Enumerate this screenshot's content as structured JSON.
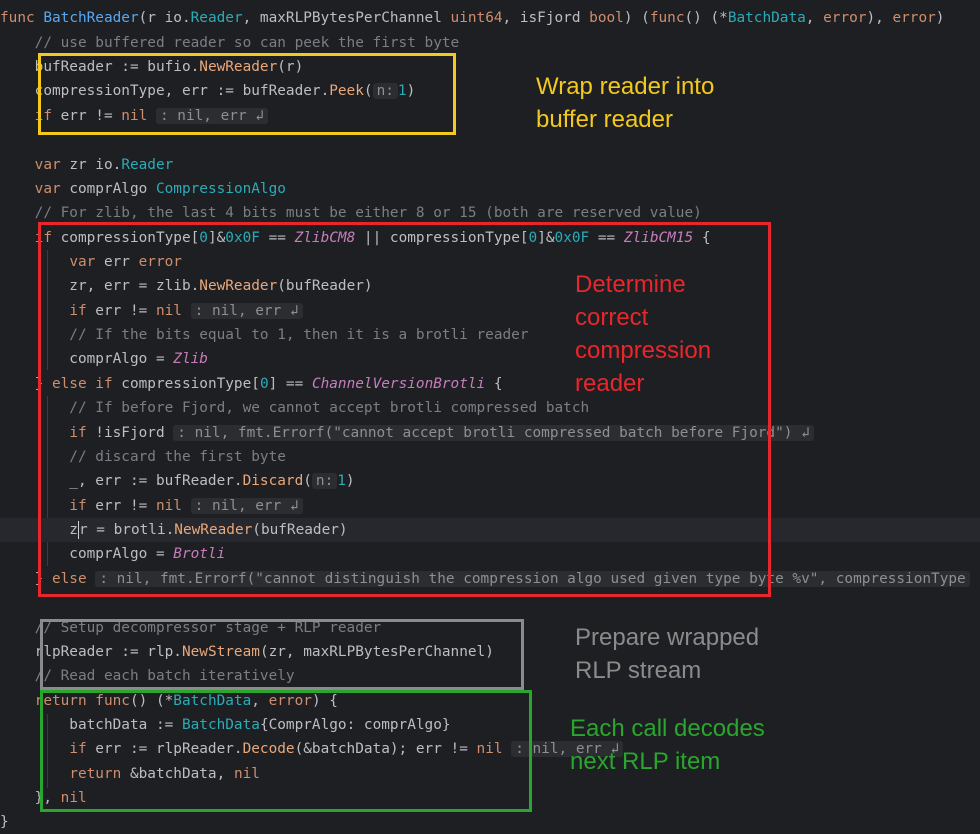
{
  "lines": {
    "l1a": "func ",
    "l1b": "BatchReader",
    "l1c": "(r io.",
    "l1d": "Reader",
    "l1e": ", maxRLPBytesPerChannel ",
    "l1f": "uint64",
    "l1g": ", isFjord ",
    "l1h": "bool",
    "l1i": ") (",
    "l1j": "func",
    "l1k": "() (*",
    "l1l": "BatchData",
    "l1m": ", ",
    "l1n": "error",
    "l1o": "), ",
    "l1p": "error",
    "l1q": ")",
    "l2": "    // use buffered reader so can peek the first byte",
    "l3a": "    bufReader := bufio.",
    "l3b": "NewReader",
    "l3c": "(r)",
    "l4a": "    compressionType, err := bufReader.",
    "l4b": "Peek",
    "l4c": "(",
    "l4hint": "n:",
    "l4d": "1",
    "l4e": ")",
    "l5a": "    ",
    "l5b": "if",
    "l5c": " err != ",
    "l5d": "nil",
    "l5hint": ": nil, err ↲",
    "l7a": "    ",
    "l7b": "var",
    "l7c": " zr io.",
    "l7d": "Reader",
    "l8a": "    ",
    "l8b": "var",
    "l8c": " comprAlgo ",
    "l8d": "CompressionAlgo",
    "l9": "    // For zlib, the last 4 bits must be either 8 or 15 (both are reserved value)",
    "l10a": "    ",
    "l10b": "if",
    "l10c": " compressionType[",
    "l10d": "0",
    "l10e": "]&",
    "l10f": "0x0F",
    "l10g": " == ",
    "l10h": "ZlibCM8",
    "l10i": " || compressionType[",
    "l10j": "0",
    "l10k": "]&",
    "l10l": "0x0F",
    "l10m": " == ",
    "l10n": "ZlibCM15",
    "l10o": " {",
    "l11a": "        ",
    "l11b": "var",
    "l11c": " err ",
    "l11d": "error",
    "l12a": "        zr, err = zlib.",
    "l12b": "NewReader",
    "l12c": "(bufReader)",
    "l13a": "        ",
    "l13b": "if",
    "l13c": " err != ",
    "l13d": "nil",
    "l13hint": ": nil, err ↲",
    "l14": "        // If the bits equal to 1, then it is a brotli reader",
    "l15a": "        comprAlgo = ",
    "l15b": "Zlib",
    "l16a": "    } ",
    "l16b": "else if",
    "l16c": " compressionType[",
    "l16d": "0",
    "l16e": "] == ",
    "l16f": "ChannelVersionBrotli",
    "l16g": " {",
    "l17": "        // If before Fjord, we cannot accept brotli compressed batch",
    "l18a": "        ",
    "l18b": "if",
    "l18c": " !isFjord ",
    "l18hint": ": nil, fmt.Errorf(\"cannot accept brotli compressed batch before Fjord\") ↲",
    "l19": "        // discard the first byte",
    "l20a": "        _, err := bufReader.",
    "l20b": "Discard",
    "l20c": "(",
    "l20hint": "n:",
    "l20d": "1",
    "l20e": ")",
    "l21a": "        ",
    "l21b": "if",
    "l21c": " err != ",
    "l21d": "nil",
    "l21hint": ": nil, err ↲",
    "l22a": "        z",
    "l22b": "r = brotli.",
    "l22c": "NewReader",
    "l22d": "(bufReader)",
    "l23a": "        comprAlgo = ",
    "l23b": "Brotli",
    "l24a": "    } ",
    "l24b": "else",
    "l24c": " ",
    "l24hint": ": nil, fmt.Errorf(\"cannot distinguish the compression algo used given type byte %v\", compressionType",
    "l26": "    // Setup decompressor stage + RLP reader",
    "l27a": "    rlpReader := rlp.",
    "l27b": "NewStream",
    "l27c": "(zr, maxRLPBytesPerChannel)",
    "l28": "    // Read each batch iteratively",
    "l29a": "    ",
    "l29b": "return func",
    "l29c": "() (*",
    "l29d": "BatchData",
    "l29e": ", ",
    "l29f": "error",
    "l29g": ") {",
    "l30a": "        batchData := ",
    "l30b": "BatchData",
    "l30c": "{ComprAlgo: comprAlgo}",
    "l31a": "        ",
    "l31b": "if",
    "l31c": " err := rlpReader.",
    "l31d": "Decode",
    "l31e": "(&batchData); err != ",
    "l31f": "nil",
    "l31hint": ": nil, err ↲",
    "l32a": "        ",
    "l32b": "return",
    "l32c": " &batchData, ",
    "l32d": "nil",
    "l33a": "    }, ",
    "l33b": "nil",
    "l34": "}"
  },
  "annotations": {
    "yellow": [
      "Wrap reader into",
      "buffer reader"
    ],
    "red": [
      "Determine",
      "correct",
      "compression",
      "reader"
    ],
    "gray": [
      "Prepare wrapped",
      "RLP stream"
    ],
    "green": [
      "Each call decodes",
      "next RLP item"
    ]
  },
  "colors": {
    "yellow": "#f2c91c",
    "red": "#e8262b",
    "gray": "#8b8b8b",
    "green": "#2aa52e",
    "background": "#1e1f22"
  }
}
